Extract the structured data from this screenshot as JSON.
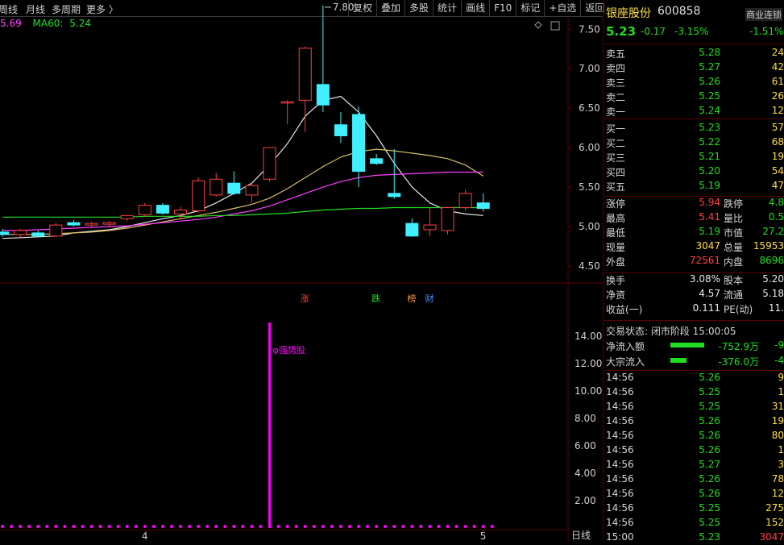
{
  "tabs": [
    "周线",
    "月线",
    "多周期",
    "更多 〉"
  ],
  "toolbar": [
    "复权",
    "叠加",
    "多股",
    "统计",
    "画线",
    "F10",
    "标记",
    "+自选",
    "返回"
  ],
  "ma_legend": {
    "ma_a": "5.69",
    "ma60_label": "MA60:",
    "ma60_value": "5.24",
    "colors": {
      "ma_a": "#ff40ff",
      "ma60": "#22dd22"
    }
  },
  "chart_data": [
    {
      "type": "candlestick",
      "title": "",
      "yticks": [
        "7.50",
        "7.00",
        "6.50",
        "6.00",
        "5.50",
        "5.00",
        "4.50"
      ],
      "ylim": [
        4.5,
        7.85
      ],
      "high_marker": "7.80",
      "candles": [
        {
          "o": 4.93,
          "h": 4.97,
          "l": 4.87,
          "c": 4.9
        },
        {
          "o": 4.9,
          "h": 4.97,
          "l": 4.86,
          "c": 4.95
        },
        {
          "o": 4.92,
          "h": 4.95,
          "l": 4.87,
          "c": 4.88
        },
        {
          "o": 4.88,
          "h": 5.05,
          "l": 4.87,
          "c": 5.02
        },
        {
          "o": 5.05,
          "h": 5.08,
          "l": 5.0,
          "c": 5.02
        },
        {
          "o": 5.02,
          "h": 5.06,
          "l": 4.99,
          "c": 5.04
        },
        {
          "o": 5.03,
          "h": 5.07,
          "l": 5.0,
          "c": 5.05
        },
        {
          "o": 5.1,
          "h": 5.14,
          "l": 5.07,
          "c": 5.14
        },
        {
          "o": 5.15,
          "h": 5.3,
          "l": 5.12,
          "c": 5.27
        },
        {
          "o": 5.27,
          "h": 5.3,
          "l": 5.15,
          "c": 5.17
        },
        {
          "o": 5.16,
          "h": 5.25,
          "l": 5.1,
          "c": 5.21
        },
        {
          "o": 5.2,
          "h": 5.62,
          "l": 5.18,
          "c": 5.58
        },
        {
          "o": 5.4,
          "h": 5.68,
          "l": 5.38,
          "c": 5.6
        },
        {
          "o": 5.55,
          "h": 5.7,
          "l": 5.4,
          "c": 5.42
        },
        {
          "o": 5.4,
          "h": 5.55,
          "l": 5.3,
          "c": 5.52
        },
        {
          "o": 5.6,
          "h": 6.0,
          "l": 5.57,
          "c": 6.0
        },
        {
          "o": 6.58,
          "h": 6.6,
          "l": 6.3,
          "c": 6.58
        },
        {
          "o": 6.6,
          "h": 7.28,
          "l": 6.2,
          "c": 7.26
        },
        {
          "o": 6.8,
          "h": 7.8,
          "l": 6.45,
          "c": 6.54
        },
        {
          "o": 6.29,
          "h": 6.45,
          "l": 6.06,
          "c": 6.15
        },
        {
          "o": 6.42,
          "h": 6.52,
          "l": 5.5,
          "c": 5.7
        },
        {
          "o": 5.86,
          "h": 5.92,
          "l": 5.78,
          "c": 5.8
        },
        {
          "o": 5.42,
          "h": 5.98,
          "l": 5.35,
          "c": 5.38
        },
        {
          "o": 5.04,
          "h": 5.1,
          "l": 4.87,
          "c": 4.88
        },
        {
          "o": 4.96,
          "h": 5.25,
          "l": 4.88,
          "c": 5.02
        },
        {
          "o": 4.95,
          "h": 5.25,
          "l": 4.9,
          "c": 5.24
        },
        {
          "o": 5.24,
          "h": 5.47,
          "l": 5.2,
          "c": 5.42
        },
        {
          "o": 5.3,
          "h": 5.42,
          "l": 5.19,
          "c": 5.23
        }
      ],
      "markers": [
        {
          "label": "涨",
          "index": 17,
          "color": "#ff4040"
        },
        {
          "label": "跌",
          "index": 21,
          "color": "#22dd22"
        },
        {
          "label": "榜",
          "index": 23,
          "color": "#ff9040"
        },
        {
          "label": "财",
          "index": 24,
          "color": "#4090ff"
        }
      ],
      "series": [
        {
          "values": [
            4.85,
            4.86,
            4.87,
            4.88,
            4.92,
            4.94,
            4.96,
            5.0,
            5.05,
            5.1,
            5.14,
            5.2,
            5.3,
            5.42,
            5.55,
            5.78,
            6.05,
            6.4,
            6.6,
            6.65,
            6.45,
            6.15,
            5.8,
            5.5,
            5.3,
            5.2,
            5.16,
            5.14
          ],
          "color": "#e8e8e8"
        },
        {
          "values": [
            4.9,
            4.9,
            4.9,
            4.91,
            4.92,
            4.93,
            4.95,
            4.98,
            5.02,
            5.06,
            5.1,
            5.14,
            5.18,
            5.23,
            5.28,
            5.36,
            5.48,
            5.62,
            5.76,
            5.88,
            5.95,
            5.98,
            5.96,
            5.93,
            5.9,
            5.86,
            5.78,
            5.64
          ],
          "color": "#d8c060"
        },
        {
          "values": [
            4.95,
            4.95,
            4.96,
            4.97,
            4.98,
            4.99,
            5.0,
            5.01,
            5.03,
            5.05,
            5.07,
            5.09,
            5.12,
            5.16,
            5.2,
            5.26,
            5.34,
            5.42,
            5.5,
            5.57,
            5.62,
            5.65,
            5.66,
            5.67,
            5.68,
            5.69,
            5.69,
            5.69
          ],
          "color": "#ff40ff"
        },
        {
          "values": [
            5.12,
            5.12,
            5.12,
            5.12,
            5.12,
            5.12,
            5.12,
            5.12,
            5.13,
            5.13,
            5.13,
            5.13,
            5.14,
            5.14,
            5.15,
            5.16,
            5.17,
            5.19,
            5.21,
            5.22,
            5.23,
            5.23,
            5.24,
            5.24,
            5.24,
            5.24,
            5.24,
            5.24
          ],
          "color": "#22dd22"
        }
      ]
    },
    {
      "type": "bar",
      "title": "",
      "yticks": [
        "14.00",
        "12.00",
        "10.00",
        "8.00",
        "6.00",
        "4.00",
        "2.00"
      ],
      "ylim": [
        0,
        15
      ],
      "signal_label": "强势股",
      "values": [
        0,
        0,
        0,
        0,
        0,
        0,
        0,
        0,
        0,
        0,
        0,
        0,
        0,
        0,
        0,
        15,
        0,
        0,
        0,
        0,
        0,
        0,
        0,
        0,
        0,
        0,
        0,
        0
      ],
      "color": "#ff00ff"
    }
  ],
  "xlabels": [
    {
      "label": "4",
      "index": 8
    },
    {
      "label": "5",
      "index": 27
    }
  ],
  "period_label": "日线",
  "stock": {
    "name": "银座股份",
    "code": "600858",
    "price": "5.23",
    "change": "-0.17",
    "pct": "-3.15%",
    "sector": "商业连锁",
    "sector_pct": "-1.51%"
  },
  "asks": [
    {
      "label": "卖五",
      "price": "5.28",
      "vol": "24"
    },
    {
      "label": "卖四",
      "price": "5.27",
      "vol": "42"
    },
    {
      "label": "卖三",
      "price": "5.26",
      "vol": "61"
    },
    {
      "label": "卖二",
      "price": "5.25",
      "vol": "26"
    },
    {
      "label": "卖一",
      "price": "5.24",
      "vol": "12"
    }
  ],
  "bids": [
    {
      "label": "买一",
      "price": "5.23",
      "vol": "57"
    },
    {
      "label": "买二",
      "price": "5.22",
      "vol": "68"
    },
    {
      "label": "买三",
      "price": "5.21",
      "vol": "19"
    },
    {
      "label": "买四",
      "price": "5.20",
      "vol": "54"
    },
    {
      "label": "买五",
      "price": "5.19",
      "vol": "47"
    }
  ],
  "stats1": [
    {
      "l1": "涨停",
      "v1": "5.94",
      "l2": "跌停",
      "v2": "4.8"
    },
    {
      "l1": "最高",
      "v1": "5.41",
      "l2": "量比",
      "v2": "0.5"
    },
    {
      "l1": "最低",
      "v1": "5.19",
      "l2": "市值",
      "v2": "27.2"
    },
    {
      "l1": "现量",
      "v1": "3047",
      "l2": "总量",
      "v2": "15953"
    },
    {
      "l1": "外盘",
      "v1": "72561",
      "l2": "内盘",
      "v2": "8696"
    }
  ],
  "stats2": [
    {
      "l1": "换手",
      "v1": "3.08%",
      "l2": "股本",
      "v2": "5.20"
    },
    {
      "l1": "净资",
      "v1": "4.57",
      "l2": "流通",
      "v2": "5.18"
    },
    {
      "l1": "收益(一)",
      "v1": "0.111",
      "l2": "PE(动)",
      "v2": "11."
    }
  ],
  "trade_status": "交易状态: 闭市阶段 15:00:05",
  "flows": [
    {
      "label": "净流入额",
      "value": "-752.9万",
      "pct": "-9"
    },
    {
      "label": "大宗流入",
      "value": "-376.0万",
      "pct": "-4"
    }
  ],
  "ticks": [
    {
      "time": "14:56",
      "price": "5.26",
      "vol": "9"
    },
    {
      "time": "14:56",
      "price": "5.25",
      "vol": "1"
    },
    {
      "time": "14:56",
      "price": "5.25",
      "vol": "31"
    },
    {
      "time": "14:56",
      "price": "5.26",
      "vol": "19"
    },
    {
      "time": "14:56",
      "price": "5.26",
      "vol": "80"
    },
    {
      "time": "14:56",
      "price": "5.26",
      "vol": "1"
    },
    {
      "time": "14:56",
      "price": "5.27",
      "vol": "3"
    },
    {
      "time": "14:56",
      "price": "5.26",
      "vol": "78"
    },
    {
      "time": "14:56",
      "price": "5.26",
      "vol": "12"
    },
    {
      "time": "14:56",
      "price": "5.25",
      "vol": "275"
    },
    {
      "time": "14:56",
      "price": "5.25",
      "vol": "152"
    },
    {
      "time": "15:00",
      "price": "5.23",
      "vol": "3047"
    }
  ]
}
